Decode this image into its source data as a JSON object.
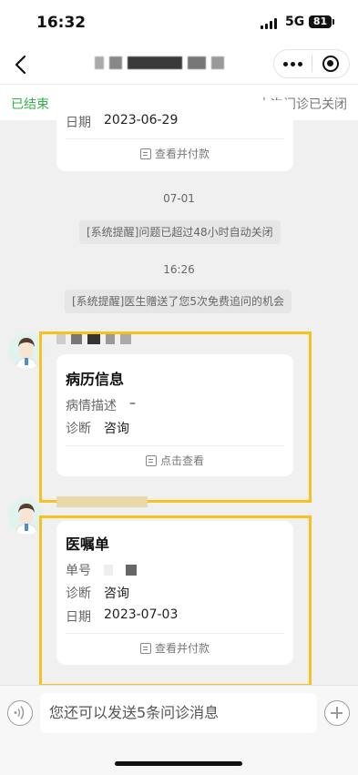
{
  "status_bar": {
    "time": "16:32",
    "network": "5G",
    "battery": "81"
  },
  "header": {
    "status_label": "已结束",
    "session_note": "本次问诊已关闭"
  },
  "top_card": {
    "date_label": "日期",
    "date_value": "2023-06-29",
    "action_label": "查看并付款"
  },
  "timeline": [
    {
      "time": "07-01",
      "system_message": "[系统提醒]问题已超过48小时自动关闭"
    },
    {
      "time": "16:26",
      "system_message": "[系统提醒]医生赠送了您5次免费追问的机会"
    }
  ],
  "medical_record_card": {
    "title": "病历信息",
    "desc_label": "病情描述",
    "desc_value": "–",
    "diagnosis_label": "诊断",
    "diagnosis_value": "咨询",
    "action_label": "点击查看"
  },
  "prescription_card": {
    "title": "医嘱单",
    "number_label": "单号",
    "diagnosis_label": "诊断",
    "diagnosis_value": "咨询",
    "date_label": "日期",
    "date_value": "2023-07-03",
    "action_label": "查看并付款"
  },
  "input": {
    "placeholder": "您还可以发送5条问诊消息"
  },
  "colors": {
    "accent_green": "#35b04a",
    "highlight_yellow": "#f7c11e"
  },
  "icons": [
    "back-icon",
    "more-icon",
    "target-icon",
    "bill-icon",
    "doctor-avatar",
    "voice-icon",
    "plus-icon"
  ]
}
